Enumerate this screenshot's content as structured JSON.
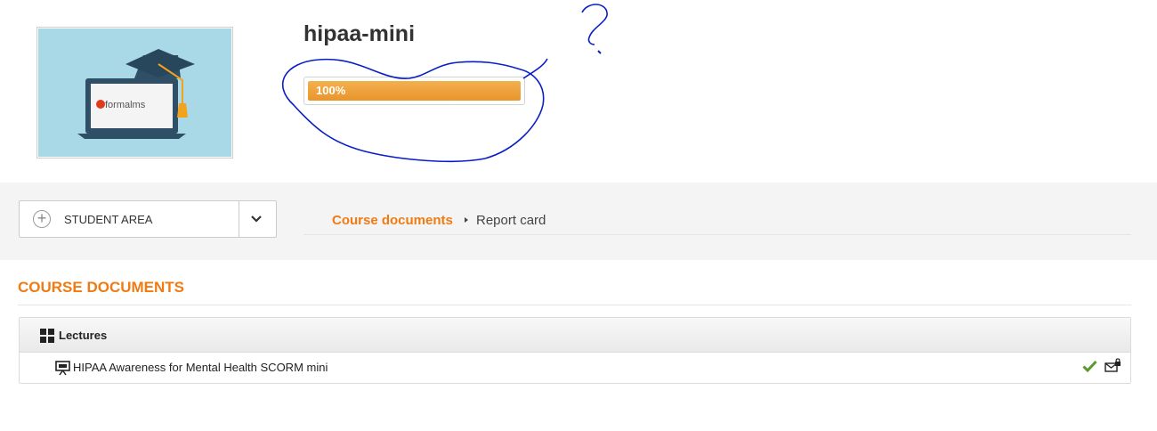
{
  "course": {
    "title": "hipaa-mini",
    "progress_label": "100%",
    "progress_value": 100,
    "thumbnail_logo_text": "formalms"
  },
  "nav": {
    "area_select": "STUDENT AREA"
  },
  "breadcrumb": {
    "parent": "Course documents",
    "current": "Report card"
  },
  "section": {
    "heading": "COURSE DOCUMENTS"
  },
  "documents": {
    "folder_label": "Lectures",
    "items": [
      {
        "label": "HIPAA Awareness for Mental Health SCORM mini",
        "status_icon": "checkmark-icon",
        "action_icon": "locked-mail-icon"
      }
    ]
  },
  "colors": {
    "accent_orange": "#f07b12",
    "progress_fill": "#ee9f35",
    "status_green": "#5a9a2a",
    "annotation_ink": "#0a1ec8"
  }
}
